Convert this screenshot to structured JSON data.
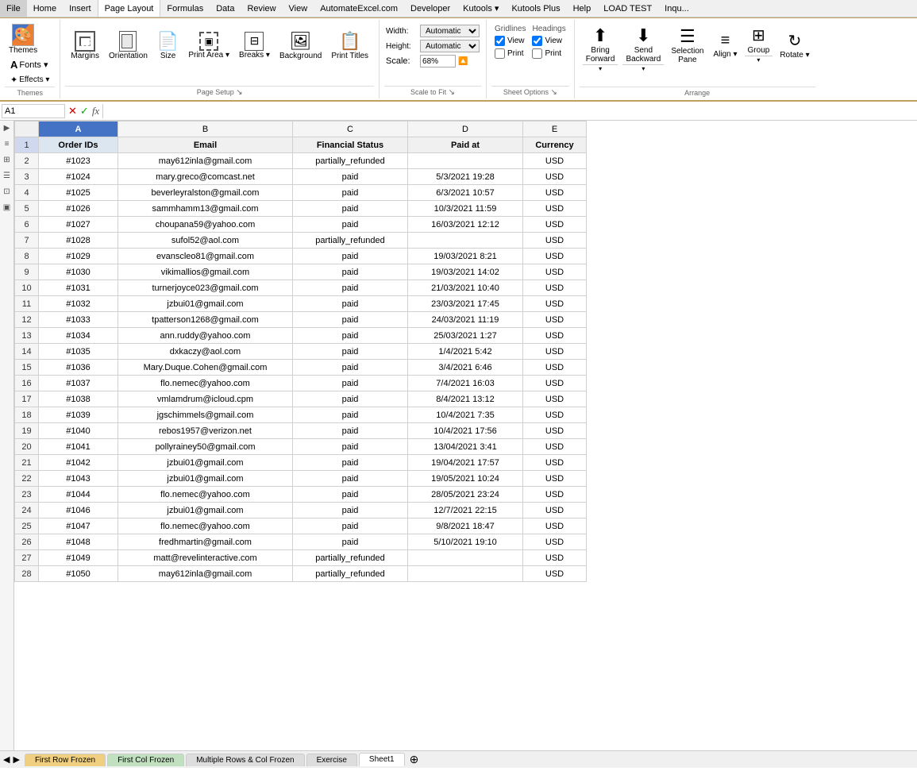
{
  "menubar": {
    "items": [
      "File",
      "Home",
      "Insert",
      "Page Layout",
      "Formulas",
      "Data",
      "Review",
      "View",
      "AutomateExcel.com",
      "Developer",
      "Kutools ▾",
      "Kutools Plus",
      "Help",
      "LOAD TEST",
      "Inqu..."
    ]
  },
  "ribbon": {
    "active_tab": "Page Layout",
    "groups": [
      {
        "name": "Themes",
        "label": "Themes",
        "buttons": [
          {
            "id": "themes",
            "icon": "🎨",
            "label": "Themes"
          },
          {
            "id": "fonts",
            "icon": "A",
            "label": "Fonts ▾"
          },
          {
            "id": "effects",
            "icon": "✦",
            "label": "Effects ▾"
          }
        ]
      },
      {
        "name": "Page Setup",
        "label": "Page Setup",
        "buttons": [
          {
            "id": "margins",
            "icon": "▭",
            "label": "Margins"
          },
          {
            "id": "orientation",
            "icon": "⬜",
            "label": "Orientation"
          },
          {
            "id": "size",
            "icon": "📄",
            "label": "Size"
          },
          {
            "id": "print-area",
            "icon": "▣",
            "label": "Print\nArea"
          },
          {
            "id": "breaks",
            "icon": "⊟",
            "label": "Breaks"
          },
          {
            "id": "background",
            "icon": "🖼",
            "label": "Background"
          },
          {
            "id": "print-titles",
            "icon": "📋",
            "label": "Print\nTitles"
          }
        ]
      },
      {
        "name": "Scale to Fit",
        "label": "Scale to Fit",
        "width_label": "Width:",
        "width_value": "Automatic",
        "height_label": "Height:",
        "height_value": "Automatic",
        "scale_label": "Scale:",
        "scale_value": "68%"
      },
      {
        "name": "Sheet Options",
        "label": "Sheet Options",
        "gridlines_label": "Gridlines",
        "headings_label": "Headings",
        "view_label": "View",
        "print_label": "Print"
      },
      {
        "name": "Arrange",
        "label": "Arrange",
        "buttons": [
          {
            "id": "bring-forward",
            "icon": "⬆",
            "label": "Bring\nForward"
          },
          {
            "id": "send-backward",
            "icon": "⬇",
            "label": "Send\nBackward"
          },
          {
            "id": "selection-pane",
            "icon": "☰",
            "label": "Selection\nPane"
          },
          {
            "id": "align",
            "icon": "≡",
            "label": "Align"
          },
          {
            "id": "group",
            "icon": "⊞",
            "label": "Group"
          },
          {
            "id": "rotate",
            "icon": "↻",
            "label": "Rotate"
          }
        ]
      }
    ]
  },
  "formula_bar": {
    "name_box": "A1",
    "formula_content": "Order IDs"
  },
  "spreadsheet": {
    "columns": [
      "A",
      "B",
      "C",
      "D",
      "E"
    ],
    "headers": [
      "Order IDs",
      "Email",
      "Financial Status",
      "Paid at",
      "Currency"
    ],
    "rows": [
      {
        "num": 2,
        "a": "#1023",
        "b": "may612inla@gmail.com",
        "c": "partially_refunded",
        "d": "",
        "e": "USD"
      },
      {
        "num": 3,
        "a": "#1024",
        "b": "mary.greco@comcast.net",
        "c": "paid",
        "d": "5/3/2021 19:28",
        "e": "USD"
      },
      {
        "num": 4,
        "a": "#1025",
        "b": "beverleyralston@gmail.com",
        "c": "paid",
        "d": "6/3/2021 10:57",
        "e": "USD"
      },
      {
        "num": 5,
        "a": "#1026",
        "b": "sammhamm13@gmail.com",
        "c": "paid",
        "d": "10/3/2021 11:59",
        "e": "USD"
      },
      {
        "num": 6,
        "a": "#1027",
        "b": "choupana59@yahoo.com",
        "c": "paid",
        "d": "16/03/2021 12:12",
        "e": "USD"
      },
      {
        "num": 7,
        "a": "#1028",
        "b": "sufol52@aol.com",
        "c": "partially_refunded",
        "d": "",
        "e": "USD"
      },
      {
        "num": 8,
        "a": "#1029",
        "b": "evanscleo81@gmail.com",
        "c": "paid",
        "d": "19/03/2021 8:21",
        "e": "USD"
      },
      {
        "num": 9,
        "a": "#1030",
        "b": "vikimallios@gmail.com",
        "c": "paid",
        "d": "19/03/2021 14:02",
        "e": "USD"
      },
      {
        "num": 10,
        "a": "#1031",
        "b": "turnerjoyce023@gmail.com",
        "c": "paid",
        "d": "21/03/2021 10:40",
        "e": "USD"
      },
      {
        "num": 11,
        "a": "#1032",
        "b": "jzbui01@gmail.com",
        "c": "paid",
        "d": "23/03/2021 17:45",
        "e": "USD"
      },
      {
        "num": 12,
        "a": "#1033",
        "b": "tpatterson1268@gmail.com",
        "c": "paid",
        "d": "24/03/2021 11:19",
        "e": "USD"
      },
      {
        "num": 13,
        "a": "#1034",
        "b": "ann.ruddy@yahoo.com",
        "c": "paid",
        "d": "25/03/2021 1:27",
        "e": "USD"
      },
      {
        "num": 14,
        "a": "#1035",
        "b": "dxkaczy@aol.com",
        "c": "paid",
        "d": "1/4/2021 5:42",
        "e": "USD"
      },
      {
        "num": 15,
        "a": "#1036",
        "b": "Mary.Duque.Cohen@gmail.com",
        "c": "paid",
        "d": "3/4/2021 6:46",
        "e": "USD"
      },
      {
        "num": 16,
        "a": "#1037",
        "b": "flo.nemec@yahoo.com",
        "c": "paid",
        "d": "7/4/2021 16:03",
        "e": "USD"
      },
      {
        "num": 17,
        "a": "#1038",
        "b": "vmlamdrum@icloud.cpm",
        "c": "paid",
        "d": "8/4/2021 13:12",
        "e": "USD"
      },
      {
        "num": 18,
        "a": "#1039",
        "b": "jgschimmels@gmail.com",
        "c": "paid",
        "d": "10/4/2021 7:35",
        "e": "USD"
      },
      {
        "num": 19,
        "a": "#1040",
        "b": "rebos1957@verizon.net",
        "c": "paid",
        "d": "10/4/2021 17:56",
        "e": "USD"
      },
      {
        "num": 20,
        "a": "#1041",
        "b": "pollyrainey50@gmail.com",
        "c": "paid",
        "d": "13/04/2021 3:41",
        "e": "USD"
      },
      {
        "num": 21,
        "a": "#1042",
        "b": "jzbui01@gmail.com",
        "c": "paid",
        "d": "19/04/2021 17:57",
        "e": "USD"
      },
      {
        "num": 22,
        "a": "#1043",
        "b": "jzbui01@gmail.com",
        "c": "paid",
        "d": "19/05/2021 10:24",
        "e": "USD"
      },
      {
        "num": 23,
        "a": "#1044",
        "b": "flo.nemec@yahoo.com",
        "c": "paid",
        "d": "28/05/2021 23:24",
        "e": "USD"
      },
      {
        "num": 24,
        "a": "#1046",
        "b": "jzbui01@gmail.com",
        "c": "paid",
        "d": "12/7/2021 22:15",
        "e": "USD"
      },
      {
        "num": 25,
        "a": "#1047",
        "b": "flo.nemec@yahoo.com",
        "c": "paid",
        "d": "9/8/2021 18:47",
        "e": "USD"
      },
      {
        "num": 26,
        "a": "#1048",
        "b": "fredhmartin@gmail.com",
        "c": "paid",
        "d": "5/10/2021 19:10",
        "e": "USD"
      },
      {
        "num": 27,
        "a": "#1049",
        "b": "matt@revelinteractive.com",
        "c": "partially_refunded",
        "d": "",
        "e": "USD"
      },
      {
        "num": 28,
        "a": "#1050",
        "b": "may612inla@gmail.com",
        "c": "partially_refunded",
        "d": "",
        "e": "USD"
      }
    ]
  },
  "sheet_tabs": [
    {
      "label": "First Row Frozen",
      "color": "orange",
      "active": false
    },
    {
      "label": "First Col Frozen",
      "color": "green",
      "active": false
    },
    {
      "label": "Multiple Rows & Col Frozen",
      "color": "default",
      "active": false
    },
    {
      "label": "Exercise",
      "color": "default",
      "active": false
    },
    {
      "label": "Sheet1",
      "color": "default",
      "active": true
    }
  ],
  "left_icons": [
    "▶",
    "≡",
    "⊞",
    "☰",
    "⊡",
    "▣"
  ]
}
